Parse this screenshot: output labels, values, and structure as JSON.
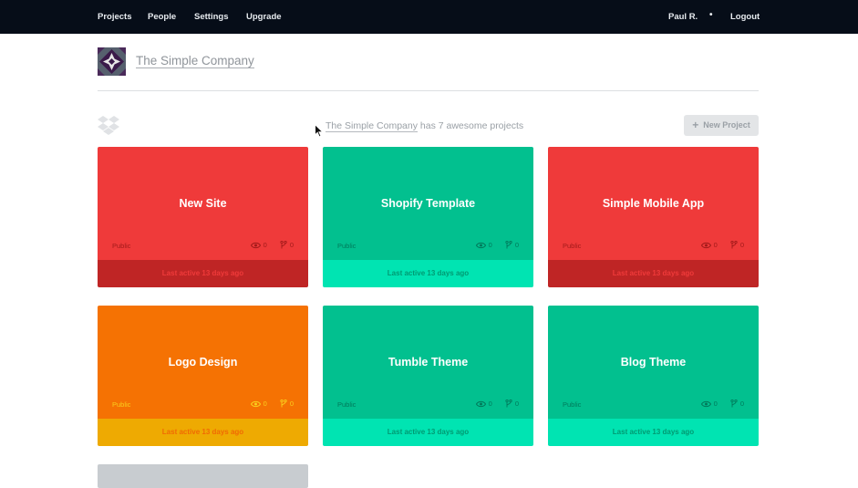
{
  "nav": {
    "left": [
      "Projects",
      "People",
      "Settings",
      "Upgrade"
    ],
    "user": "Paul R.",
    "separator": "•",
    "logout": "Logout"
  },
  "company": {
    "name": "The Simple Company"
  },
  "summary": {
    "company_link": "The Simple Company",
    "text": "has 7 awesome projects"
  },
  "new_project_button": {
    "icon": "plus-icon",
    "label": "New Project"
  },
  "colors": {
    "red": "#ef3a3a",
    "green": "#02c08f",
    "orange": "#f57203"
  },
  "projects": [
    {
      "title": "New Site",
      "visibility": "Public",
      "views": "0",
      "forks": "0",
      "last_active": "Last active 13 days ago",
      "color": "red"
    },
    {
      "title": "Shopify Template",
      "visibility": "Public",
      "views": "0",
      "forks": "0",
      "last_active": "Last active 13 days ago",
      "color": "green"
    },
    {
      "title": "Simple Mobile App",
      "visibility": "Public",
      "views": "0",
      "forks": "0",
      "last_active": "Last active 13 days ago",
      "color": "red"
    },
    {
      "title": "Logo Design",
      "visibility": "Public",
      "views": "0",
      "forks": "0",
      "last_active": "Last active 13 days ago",
      "color": "orange"
    },
    {
      "title": "Tumble Theme",
      "visibility": "Public",
      "views": "0",
      "forks": "0",
      "last_active": "Last active 13 days ago",
      "color": "green"
    },
    {
      "title": "Blog Theme",
      "visibility": "Public",
      "views": "0",
      "forks": "0",
      "last_active": "Last active 13 days ago",
      "color": "green"
    }
  ]
}
